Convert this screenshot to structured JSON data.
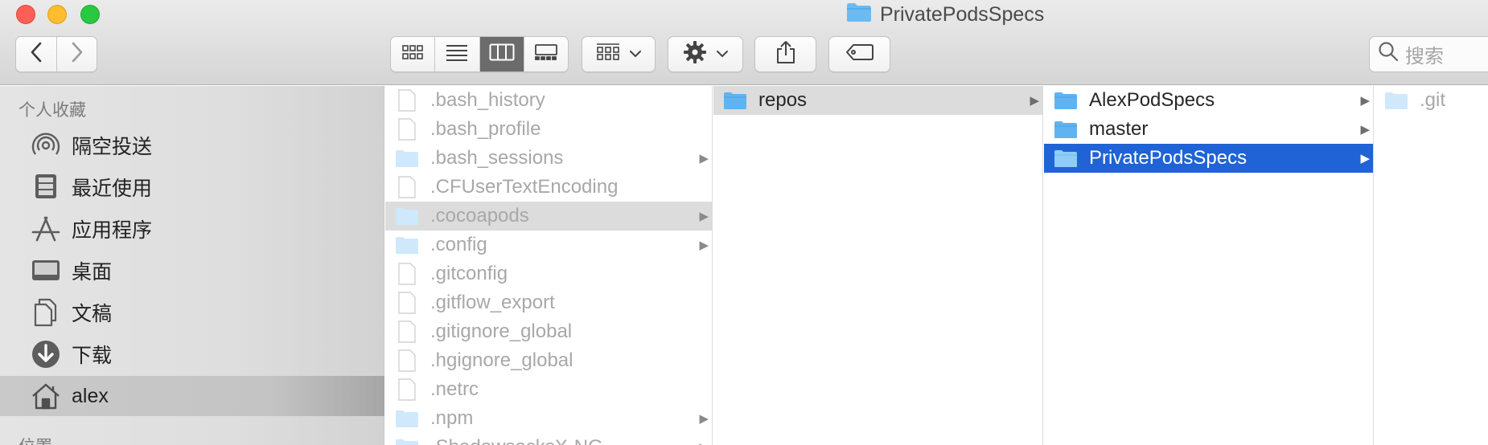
{
  "window": {
    "title": "PrivatePodsSpecs"
  },
  "toolbar": {
    "search_placeholder": "搜索",
    "active_view": "columns"
  },
  "sidebar": {
    "favorites_heading": "个人收藏",
    "locations_heading": "位置",
    "items": [
      {
        "label": "隔空投送",
        "icon": "airdrop-icon"
      },
      {
        "label": "最近使用",
        "icon": "recents-icon"
      },
      {
        "label": "应用程序",
        "icon": "applications-icon"
      },
      {
        "label": "桌面",
        "icon": "desktop-icon"
      },
      {
        "label": "文稿",
        "icon": "documents-icon"
      },
      {
        "label": "下载",
        "icon": "downloads-icon"
      },
      {
        "label": "alex",
        "icon": "home-icon"
      }
    ],
    "selected": "alex"
  },
  "columns": [
    {
      "items": [
        {
          "name": ".bash_history",
          "kind": "file"
        },
        {
          "name": ".bash_profile",
          "kind": "file"
        },
        {
          "name": ".bash_sessions",
          "kind": "folder"
        },
        {
          "name": ".CFUserTextEncoding",
          "kind": "file"
        },
        {
          "name": ".cocoapods",
          "kind": "folder",
          "state": "path"
        },
        {
          "name": ".config",
          "kind": "folder"
        },
        {
          "name": ".gitconfig",
          "kind": "file"
        },
        {
          "name": ".gitflow_export",
          "kind": "file"
        },
        {
          "name": ".gitignore_global",
          "kind": "file"
        },
        {
          "name": ".hgignore_global",
          "kind": "file"
        },
        {
          "name": ".netrc",
          "kind": "file"
        },
        {
          "name": ".npm",
          "kind": "folder"
        },
        {
          "name": ".ShadowsocksX-NG",
          "kind": "folder"
        }
      ]
    },
    {
      "items": [
        {
          "name": "repos",
          "kind": "folder",
          "state": "path"
        }
      ]
    },
    {
      "items": [
        {
          "name": "AlexPodSpecs",
          "kind": "folder"
        },
        {
          "name": "master",
          "kind": "folder"
        },
        {
          "name": "PrivatePodsSpecs",
          "kind": "folder",
          "state": "selected"
        }
      ]
    },
    {
      "items": [
        {
          "name": ".git",
          "kind": "folder"
        }
      ]
    }
  ],
  "colors": {
    "selection": "#1f63d6",
    "folder": "#5fb3f0",
    "hidden_text": "#a8a8a8"
  }
}
